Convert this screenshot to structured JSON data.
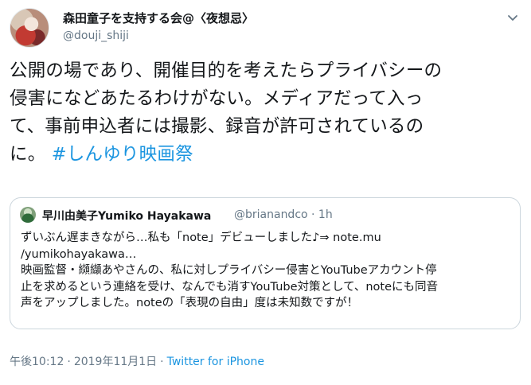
{
  "author": {
    "name": "森田童子を支持する会@〈夜想忌〉",
    "handle": "@douji_shiji"
  },
  "tweet": {
    "lines": [
      "公開の場であり、開催目的を考えたらプライバシーの",
      "侵害になどあたるわけがない。メディアだって入っ",
      "て、事前申込者には撮影、録音が許可されているの",
      "に。 "
    ],
    "hashtag": "#しんゆり映画祭"
  },
  "quoted": {
    "name": "早川由美子Yumiko Hayakawa",
    "handle": "@brianandco · 1h",
    "lines": [
      "ずいぶん遅まきながら…私も「note」デビューしました♪⇒ note.mu",
      "/yumikohayakawa…",
      "映画監督・纐纈あやさんの、私に対しプライバシー侵害とYouTubeアカウント停",
      "止を求めるという連絡を受け、なんでも消すYouTube対策として、noteにも同音",
      "声をアップしました。noteの「表現の自由」度は未知数ですが！"
    ]
  },
  "meta": {
    "time": "午後10:12",
    "date": "2019年11月1日",
    "separator": "·",
    "source": "Twitter for iPhone"
  },
  "colors": {
    "link": "#1b95e0",
    "secondary_text": "#657786",
    "border": "#ccd6dd"
  },
  "icons": {
    "menu": "chevron-down-icon"
  }
}
